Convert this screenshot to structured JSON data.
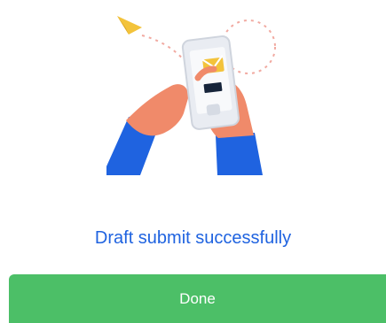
{
  "status": {
    "message": "Draft submit successfully"
  },
  "actions": {
    "done_label": "Done"
  },
  "illustration": {
    "icon": "phone-send-mail-illustration",
    "colors": {
      "sleeve": "#1f63e0",
      "skin": "#f08a6a",
      "phone": "#e9ecf2",
      "envelope": "#f3c33b",
      "paper_plane": "#f3c33b",
      "dots": "#f1a9a0",
      "circle": "#eeeeee"
    }
  },
  "colors": {
    "accent_text": "#1f63e0",
    "done_button": "#4cbf67",
    "background": "#ffffff"
  }
}
